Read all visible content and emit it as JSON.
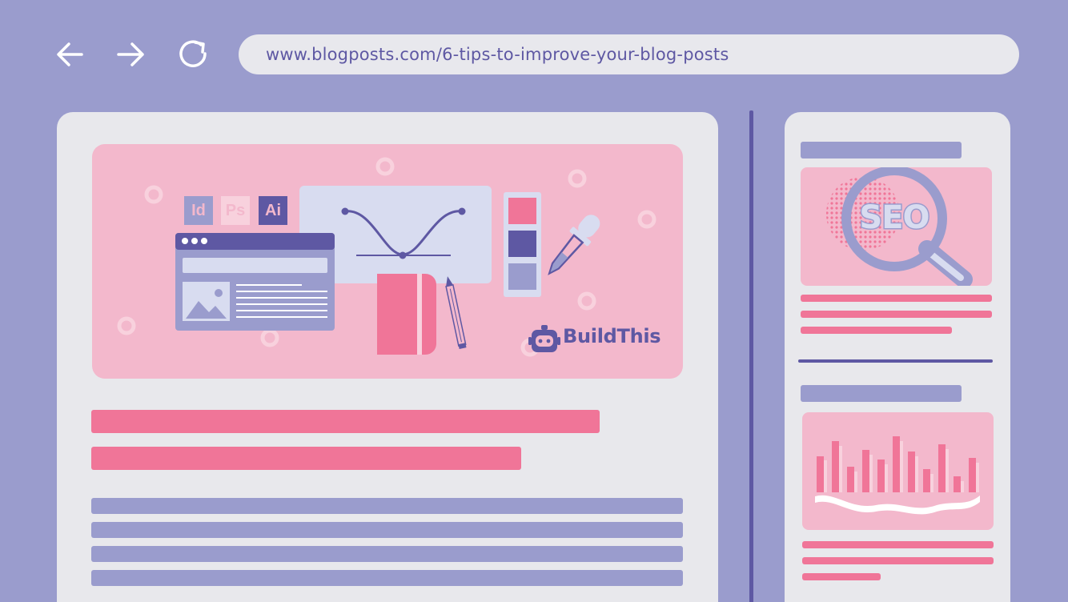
{
  "browser": {
    "url": "www.blogposts.com/6-tips-to-improve-your-blog-posts",
    "back_icon": "arrow-left-icon",
    "forward_icon": "arrow-right-icon",
    "reload_icon": "reload-icon"
  },
  "hero": {
    "apps": [
      "Id",
      "Ps",
      "Ai"
    ],
    "logo": "BuildThis"
  },
  "sidebar": {
    "seo_label": "SEO"
  },
  "colors": {
    "background": "#9a9ccd",
    "panel": "#e8e8ec",
    "pink": "#f07598",
    "light_pink": "#f3b8cc",
    "indigo": "#5e58a3",
    "lavender": "#9a9ccd"
  }
}
